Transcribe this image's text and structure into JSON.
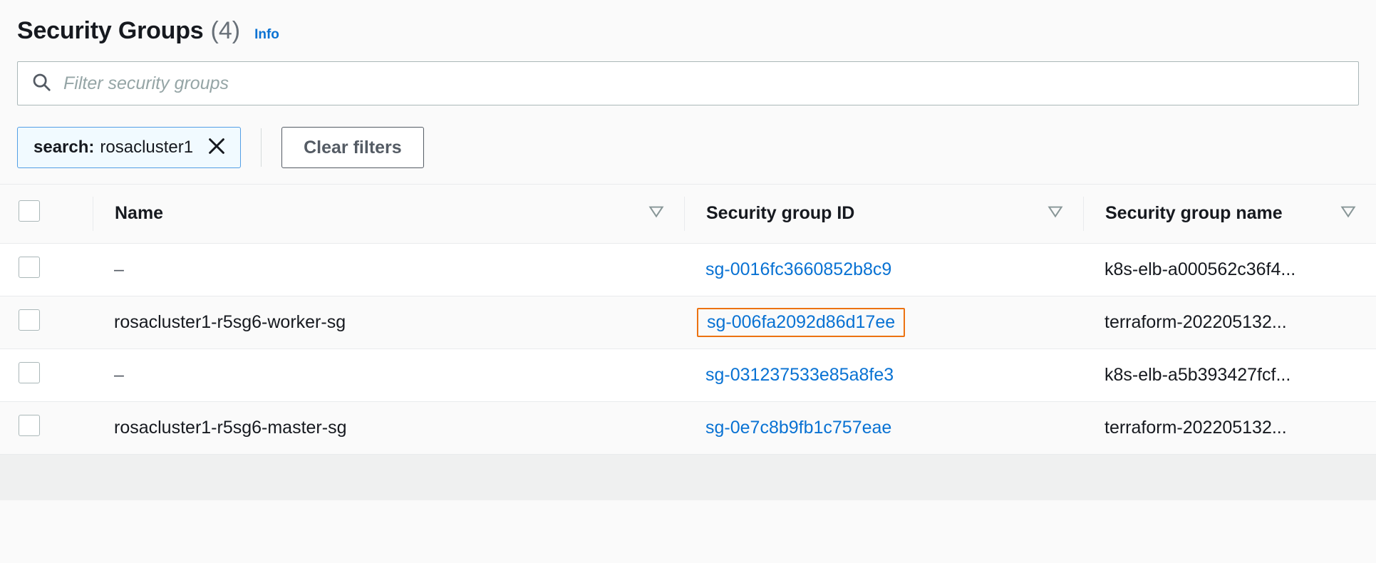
{
  "header": {
    "title": "Security Groups",
    "count": "(4)",
    "info_label": "Info"
  },
  "search": {
    "placeholder": "Filter security groups",
    "value": "",
    "icon": "search-icon"
  },
  "filters": {
    "token": {
      "prefix": "search:",
      "value": "rosacluster1",
      "dismiss_icon": "close-icon"
    },
    "clear_label": "Clear filters"
  },
  "table": {
    "select_all_label": "",
    "columns": [
      {
        "label": "Name",
        "sort_icon": "sort-descending-icon"
      },
      {
        "label": "Security group ID",
        "sort_icon": "sort-descending-icon"
      },
      {
        "label": "Security group name",
        "sort_icon": "sort-descending-icon"
      }
    ],
    "rows": [
      {
        "name": "–",
        "sg_id": "sg-0016fc3660852b8c9",
        "sg_name": "k8s-elb-a000562c36f4..."
      },
      {
        "name": "rosacluster1-r5sg6-worker-sg",
        "sg_id": "sg-006fa2092d86d17ee",
        "sg_name": "terraform-202205132..."
      },
      {
        "name": "–",
        "sg_id": "sg-031237533e85a8fe3",
        "sg_name": "k8s-elb-a5b393427fcf..."
      },
      {
        "name": "rosacluster1-r5sg6-master-sg",
        "sg_id": "sg-0e7c8b9fb1c757eae",
        "sg_name": "terraform-202205132..."
      }
    ]
  },
  "colors": {
    "link": "#0972d3",
    "focus_ring": "#ec7211",
    "token_bg": "#f1faff",
    "token_border": "#539fe5",
    "text": "#16191f",
    "muted": "#687078"
  }
}
